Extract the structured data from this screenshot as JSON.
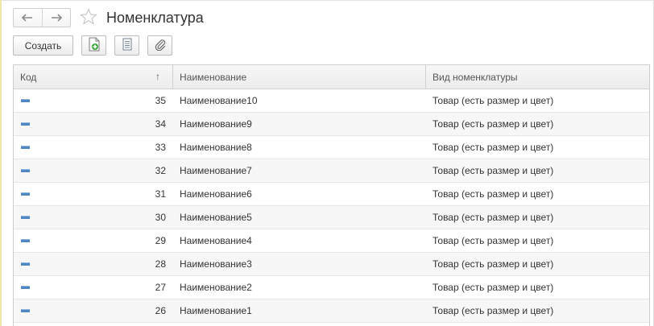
{
  "window": {
    "title": "Номенклатура"
  },
  "nav": {
    "back_icon": "arrow-left-icon",
    "forward_icon": "arrow-right-icon",
    "favorite_icon": "star-icon"
  },
  "toolbar": {
    "create_label": "Создать",
    "icons": [
      "create-copy-icon",
      "list-icon",
      "attachment-icon"
    ]
  },
  "table": {
    "columns": {
      "code": "Код",
      "name": "Наименование",
      "type": "Вид номенклатуры"
    },
    "sort_indicator": "↑",
    "rows": [
      {
        "code": "35",
        "name": "Наименование10",
        "type": "Товар (есть размер и цвет)"
      },
      {
        "code": "34",
        "name": "Наименование9",
        "type": "Товар (есть размер и цвет)"
      },
      {
        "code": "33",
        "name": "Наименование8",
        "type": "Товар (есть размер и цвет)"
      },
      {
        "code": "32",
        "name": "Наименование7",
        "type": "Товар (есть размер и цвет)"
      },
      {
        "code": "31",
        "name": "Наименование6",
        "type": "Товар (есть размер и цвет)"
      },
      {
        "code": "30",
        "name": "Наименование5",
        "type": "Товар (есть размер и цвет)"
      },
      {
        "code": "29",
        "name": "Наименование4",
        "type": "Товар (есть размер и цвет)"
      },
      {
        "code": "28",
        "name": "Наименование3",
        "type": "Товар (есть размер и цвет)"
      },
      {
        "code": "27",
        "name": "Наименование2",
        "type": "Товар (есть размер и цвет)"
      },
      {
        "code": "26",
        "name": "Наименование1",
        "type": "Товар (есть размер и цвет)"
      }
    ]
  },
  "colors": {
    "row_marker": "#4f87c4",
    "accent_left": "#f2e6a6"
  }
}
